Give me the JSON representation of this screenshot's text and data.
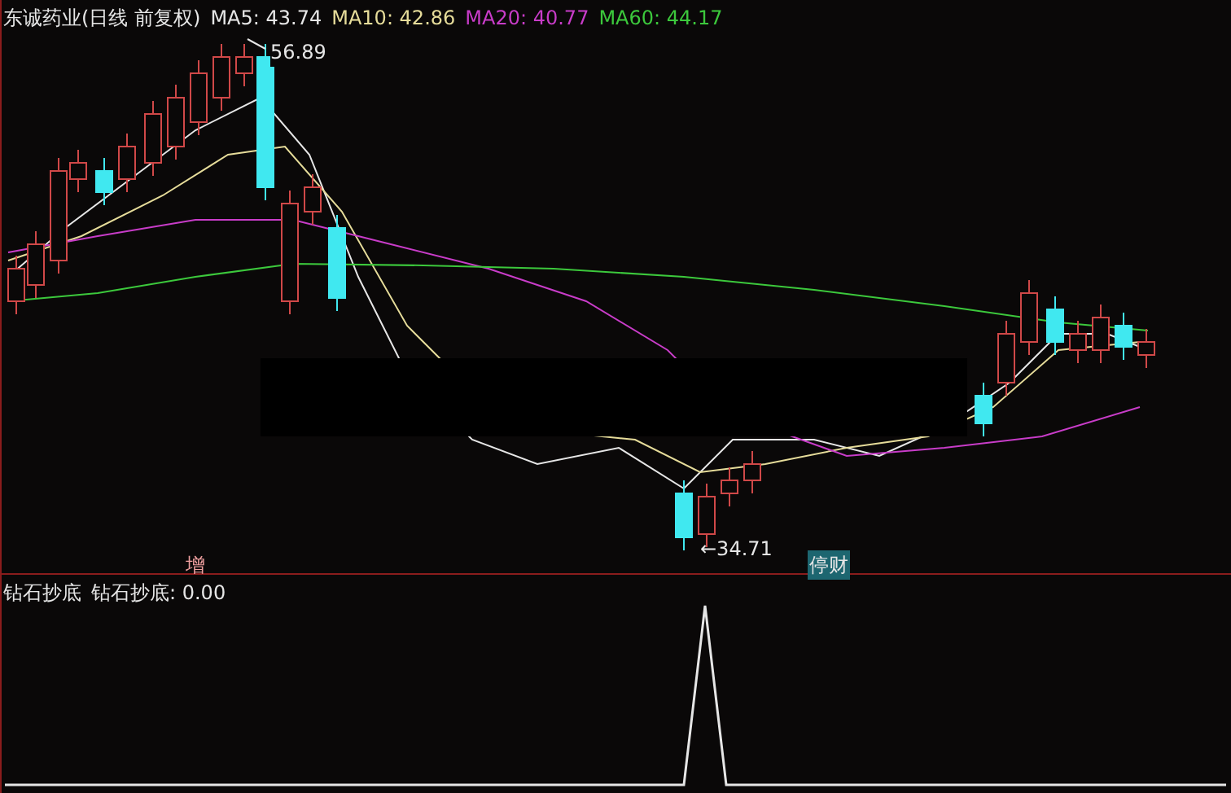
{
  "title": "东诚药业(日线 前复权)",
  "indicators": [
    {
      "label": "MA5: 43.74",
      "color": "#e6e6e6"
    },
    {
      "label": "MA10: 42.86",
      "color": "#e6dc9a"
    },
    {
      "label": "MA20: 40.77",
      "color": "#c83cc8"
    },
    {
      "label": "MA60: 44.17",
      "color": "#3cc83c"
    }
  ],
  "high_label": "56.89",
  "low_label": "←34.71",
  "markers": [
    {
      "text": "增",
      "kind": "plain"
    },
    {
      "text": "停财",
      "kind": "boxed"
    }
  ],
  "indicator_panel": {
    "title": "钻石抄底",
    "value_label": "钻石抄底: 0.00"
  }
}
